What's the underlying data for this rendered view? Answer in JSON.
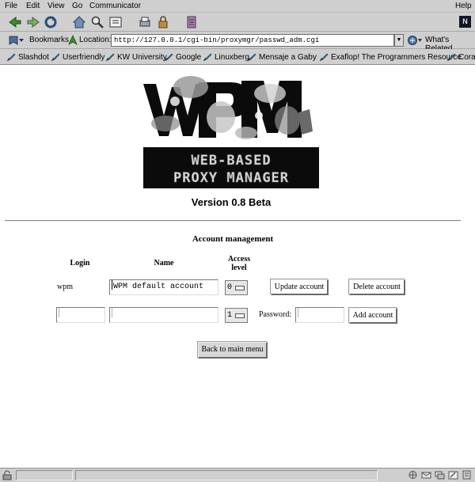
{
  "menu": {
    "items": [
      "File",
      "Edit",
      "View",
      "Go",
      "Communicator"
    ],
    "help": "Help"
  },
  "toolbar": {
    "buttons": [
      "back-icon",
      "forward-icon",
      "reload-icon",
      "home-icon",
      "search-icon",
      "netscape-guide-icon",
      "print-icon",
      "security-icon",
      "stop-icon"
    ]
  },
  "location": {
    "bookmarks_label": "Bookmarks",
    "location_label": "Location:",
    "url": "http://127.0.0.1/cgi-bin/proxymgr/passwd_adm.cgi",
    "whats_related": "What's Related"
  },
  "personal_toolbar": [
    "Slashdot",
    "Userfriendly",
    "KW University",
    "Google",
    "Linuxberg",
    "Mensaje a Gaby",
    "Exaflop! The Programmers Resource",
    "Cora"
  ],
  "page": {
    "logo_text": "WPM",
    "logo_tag_line1": "WEB-BASED",
    "logo_tag_line2": "PROXY MANAGER",
    "version": "Version 0.8 Beta",
    "section_title": "Account management",
    "headers": {
      "login": "Login",
      "name": "Name",
      "access_line1": "Access",
      "access_line2": "level"
    },
    "existing_account": {
      "login": "wpm",
      "name": "WPM default account",
      "access_level": "0",
      "update_label": "Update account",
      "delete_label": "Delete account"
    },
    "new_account": {
      "login": "",
      "name": "",
      "access_level": "1",
      "password_label": "Password:",
      "password": "",
      "add_label": "Add account"
    },
    "back_label": "Back to main menu"
  },
  "colors": {
    "chrome": "#cfcfcf",
    "logo_black": "#0b0b0b",
    "logo_grey": "#9a9a9a"
  }
}
